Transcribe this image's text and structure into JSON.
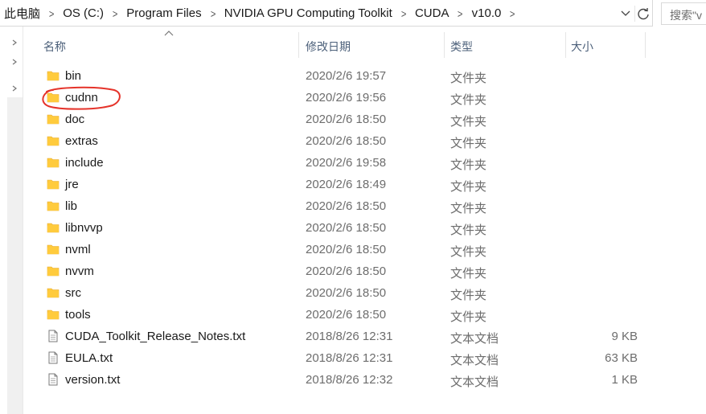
{
  "breadcrumb": {
    "items": [
      "此电脑",
      "OS (C:)",
      "Program Files",
      "NVIDIA GPU Computing Toolkit",
      "CUDA",
      "v10.0"
    ],
    "separator": ">"
  },
  "search": {
    "placeholder": "搜索\"v"
  },
  "columns": {
    "name": "名称",
    "date": "修改日期",
    "type": "类型",
    "size": "大小"
  },
  "colors": {
    "folder": "#ffcb3d",
    "folder_dark": "#e8a92a",
    "annotation": "#e5332a",
    "header_text": "#4c607a"
  },
  "files": [
    {
      "name": "bin",
      "date": "2020/2/6 19:57",
      "type": "文件夹",
      "size": "",
      "icon": "folder-icon"
    },
    {
      "name": "cudnn",
      "date": "2020/2/6 19:56",
      "type": "文件夹",
      "size": "",
      "icon": "folder-icon"
    },
    {
      "name": "doc",
      "date": "2020/2/6 18:50",
      "type": "文件夹",
      "size": "",
      "icon": "folder-icon"
    },
    {
      "name": "extras",
      "date": "2020/2/6 18:50",
      "type": "文件夹",
      "size": "",
      "icon": "folder-icon"
    },
    {
      "name": "include",
      "date": "2020/2/6 19:58",
      "type": "文件夹",
      "size": "",
      "icon": "folder-icon"
    },
    {
      "name": "jre",
      "date": "2020/2/6 18:49",
      "type": "文件夹",
      "size": "",
      "icon": "folder-icon"
    },
    {
      "name": "lib",
      "date": "2020/2/6 18:50",
      "type": "文件夹",
      "size": "",
      "icon": "folder-icon"
    },
    {
      "name": "libnvvp",
      "date": "2020/2/6 18:50",
      "type": "文件夹",
      "size": "",
      "icon": "folder-icon"
    },
    {
      "name": "nvml",
      "date": "2020/2/6 18:50",
      "type": "文件夹",
      "size": "",
      "icon": "folder-icon"
    },
    {
      "name": "nvvm",
      "date": "2020/2/6 18:50",
      "type": "文件夹",
      "size": "",
      "icon": "folder-icon"
    },
    {
      "name": "src",
      "date": "2020/2/6 18:50",
      "type": "文件夹",
      "size": "",
      "icon": "folder-icon"
    },
    {
      "name": "tools",
      "date": "2020/2/6 18:50",
      "type": "文件夹",
      "size": "",
      "icon": "folder-icon"
    },
    {
      "name": "CUDA_Toolkit_Release_Notes.txt",
      "date": "2018/8/26 12:31",
      "type": "文本文档",
      "size": "9 KB",
      "icon": "text-file-icon"
    },
    {
      "name": "EULA.txt",
      "date": "2018/8/26 12:31",
      "type": "文本文档",
      "size": "63 KB",
      "icon": "text-file-icon"
    },
    {
      "name": "version.txt",
      "date": "2018/8/26 12:32",
      "type": "文本文档",
      "size": "1 KB",
      "icon": "text-file-icon"
    }
  ]
}
